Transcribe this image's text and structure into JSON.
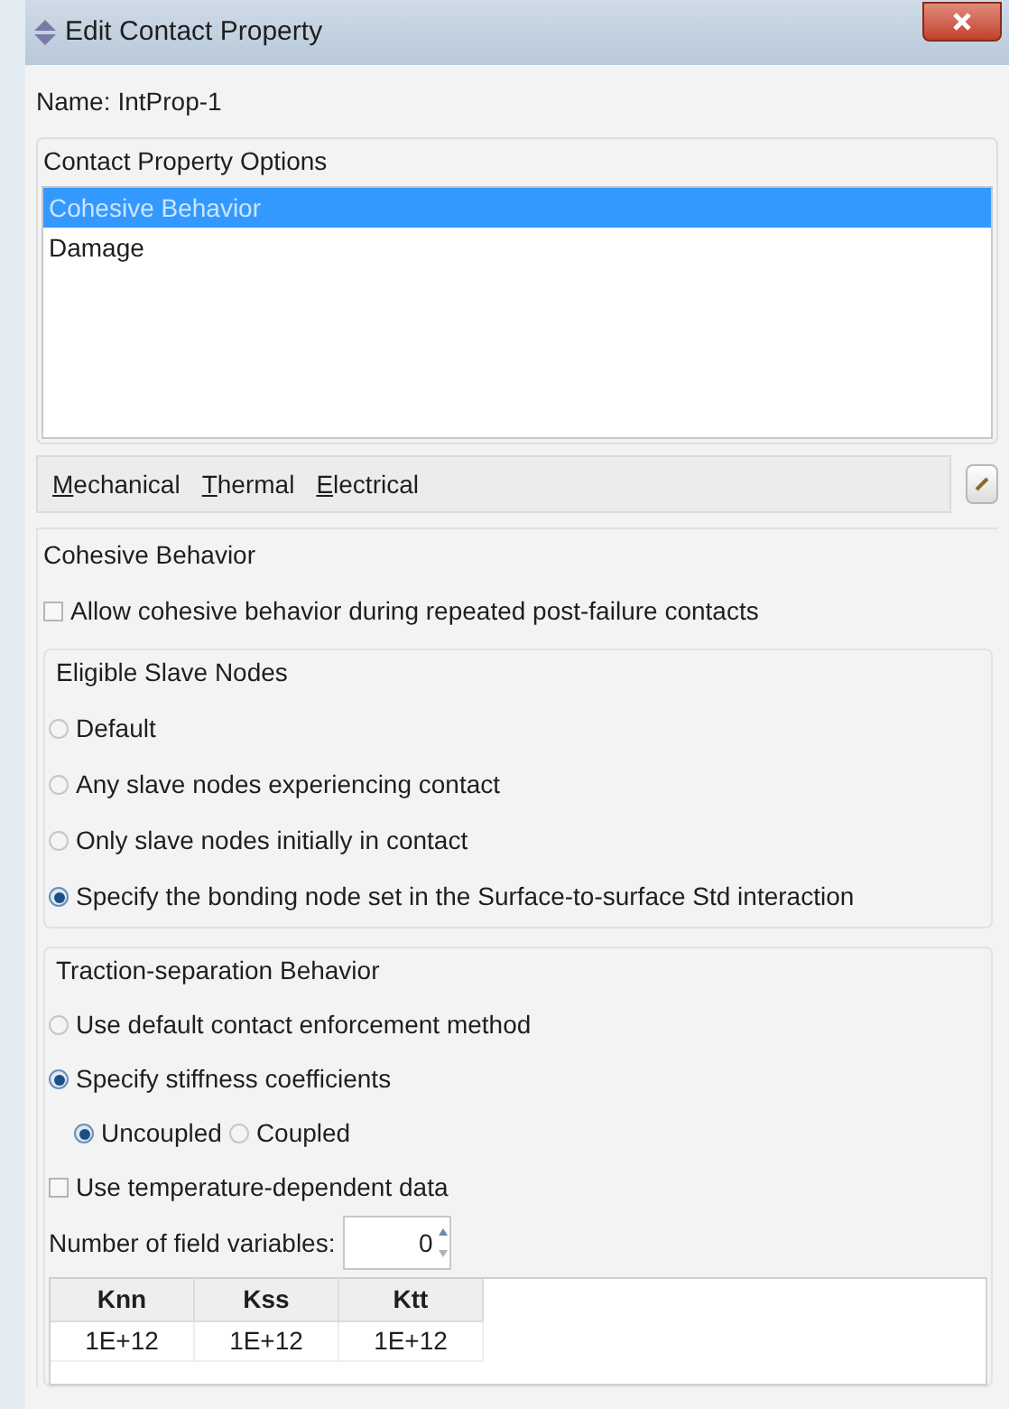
{
  "window": {
    "title": "Edit Contact Property"
  },
  "name": {
    "label": "Name:",
    "value": "IntProp-1"
  },
  "options": {
    "title": "Contact Property Options",
    "items": [
      {
        "label": "Cohesive Behavior",
        "selected": true
      },
      {
        "label": "Damage",
        "selected": false
      }
    ]
  },
  "menu": [
    "Mechanical",
    "Thermal",
    "Electrical"
  ],
  "section_title": "Cohesive Behavior",
  "allow_repeated": {
    "label": "Allow cohesive behavior during repeated post-failure contacts",
    "checked": false
  },
  "eligible": {
    "title": "Eligible Slave Nodes",
    "options": [
      {
        "label": "Default",
        "selected": false
      },
      {
        "label": "Any slave nodes experiencing contact",
        "selected": false
      },
      {
        "label": "Only slave nodes initially in contact",
        "selected": false
      },
      {
        "label": "Specify the bonding node set in the Surface-to-surface Std interaction",
        "selected": true
      }
    ]
  },
  "traction": {
    "title": "Traction-separation Behavior",
    "options": [
      {
        "label": "Use default contact enforcement method",
        "selected": false
      },
      {
        "label": "Specify stiffness coefficients",
        "selected": true
      }
    ],
    "coupling": [
      {
        "label": "Uncoupled",
        "selected": true
      },
      {
        "label": "Coupled",
        "selected": false
      }
    ],
    "temperature": {
      "label": "Use temperature-dependent data",
      "checked": false
    },
    "field_variables": {
      "label": "Number of field variables:",
      "value": "0"
    },
    "table": {
      "columns": [
        "Knn",
        "Kss",
        "Ktt"
      ],
      "rows": [
        [
          "1E+12",
          "1E+12",
          "1E+12"
        ]
      ]
    }
  }
}
